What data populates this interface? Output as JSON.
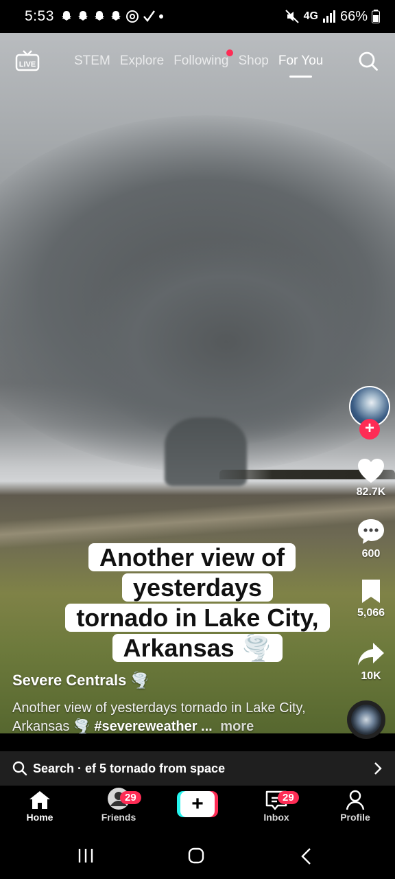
{
  "status_bar": {
    "time": "5:53",
    "notifications": [
      "snapchat-icon",
      "snapchat-icon",
      "snapchat-icon",
      "snapchat-icon",
      "threads-icon",
      "check-icon",
      "dot"
    ],
    "network": "4G",
    "battery": "66%"
  },
  "top_nav": {
    "live_label": "LIVE",
    "tabs": [
      {
        "label": "STEM"
      },
      {
        "label": "Explore"
      },
      {
        "label": "Following"
      },
      {
        "label": "Shop"
      },
      {
        "label": "For You"
      }
    ],
    "active_tab": "For You"
  },
  "caption_overlay": {
    "line1": "Another view of yesterdays",
    "line2": "tornado in Lake City,",
    "line3": "Arkansas 🌪️"
  },
  "rail": {
    "likes": "82.7K",
    "comments": "600",
    "saves": "5,066",
    "shares": "10K"
  },
  "post": {
    "author": "Severe Centrals 🌪️",
    "description": "Another view of yesterdays tornado in Lake City, Arkansas 🌪️",
    "hashtag": "#severeweather ...",
    "more_label": "more"
  },
  "search_bar": {
    "text": "Search · ef 5 tornado from space"
  },
  "bottom_nav": {
    "home": "Home",
    "friends": "Friends",
    "friends_badge": "29",
    "inbox": "Inbox",
    "inbox_badge": "29",
    "profile": "Profile"
  },
  "colors": {
    "accent": "#fe2c55",
    "cyan": "#25f4ee"
  }
}
